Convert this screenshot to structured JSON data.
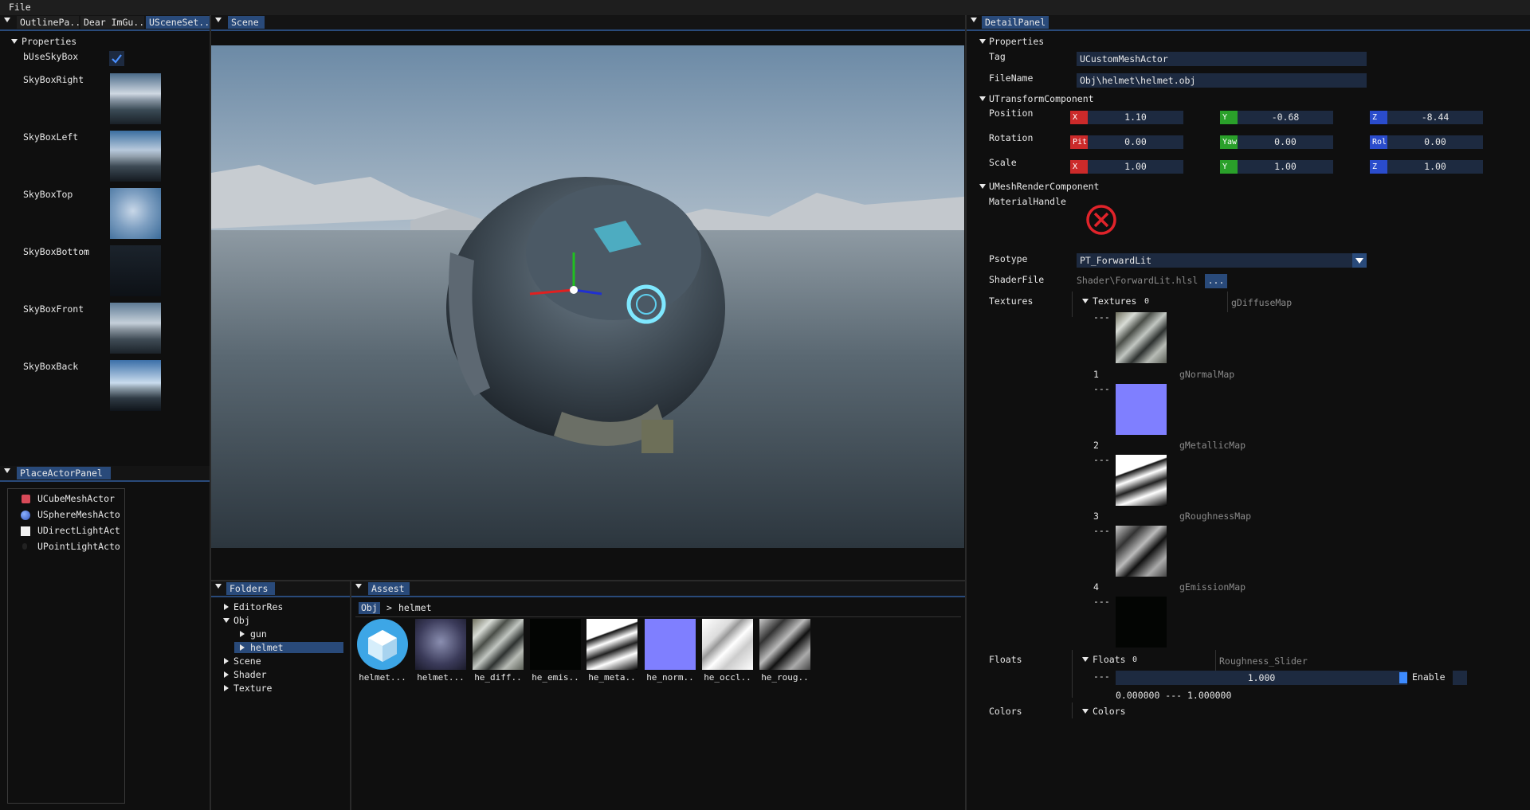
{
  "menu": {
    "file": "File"
  },
  "left_top": {
    "tabs": [
      "OutlinePa..",
      "Dear ImGu..",
      "USceneSet.."
    ],
    "section": "Properties",
    "use_skybox_label": "bUseSkyBox",
    "use_skybox_checked": true,
    "skybox": [
      {
        "label": "SkyBoxRight"
      },
      {
        "label": "SkyBoxLeft"
      },
      {
        "label": "SkyBoxTop"
      },
      {
        "label": "SkyBoxBottom"
      },
      {
        "label": "SkyBoxFront"
      },
      {
        "label": "SkyBoxBack"
      }
    ]
  },
  "place_actor": {
    "tab": "PlaceActorPanel",
    "items": [
      {
        "label": "UCubeMeshActor",
        "icon": "cube-icon"
      },
      {
        "label": "USphereMeshActo",
        "icon": "sphere-icon"
      },
      {
        "label": "UDirectLightAct",
        "icon": "sun-icon"
      },
      {
        "label": "UPointLightActo",
        "icon": "bulb-icon"
      }
    ]
  },
  "scene": {
    "tab": "Scene"
  },
  "folders": {
    "tab": "Folders",
    "items": [
      {
        "label": "EditorRes"
      },
      {
        "label": "Obj"
      },
      {
        "label": "gun"
      },
      {
        "label": "helmet"
      },
      {
        "label": "Scene"
      },
      {
        "label": "Shader"
      },
      {
        "label": "Texture"
      }
    ]
  },
  "assets": {
    "tab": "Assest",
    "breadcrumb_root": "Obj",
    "breadcrumb_sep": ">",
    "breadcrumb_current": "helmet",
    "items": [
      {
        "label": "helmet...",
        "icon": "mesh-icon"
      },
      {
        "label": "helmet...",
        "icon": "material-icon"
      },
      {
        "label": "he_diff..",
        "icon": "texture-icon"
      },
      {
        "label": "he_emis..",
        "icon": "texture-icon"
      },
      {
        "label": "he_meta..",
        "icon": "texture-icon"
      },
      {
        "label": "he_norm..",
        "icon": "texture-icon"
      },
      {
        "label": "he_occl..",
        "icon": "texture-icon"
      },
      {
        "label": "he_roug..",
        "icon": "texture-icon"
      }
    ]
  },
  "detail": {
    "tab": "DetailPanel",
    "properties": "Properties",
    "tag_label": "Tag",
    "tag_value": "UCustomMeshActor",
    "filename_label": "FileName",
    "filename_value": "Obj\\helmet\\helmet.obj",
    "transform": "UTransformComponent",
    "position_label": "Position",
    "rotation_label": "Rotation",
    "scale_label": "Scale",
    "axes": {
      "x": "X",
      "y": "Y",
      "z": "Z",
      "pitch": "Pit",
      "yaw": "Yaw",
      "roll": "Rol"
    },
    "position": [
      "1.10",
      "-0.68",
      "-8.44"
    ],
    "rotation": [
      "0.00",
      "0.00",
      "0.00"
    ],
    "scale": [
      "1.00",
      "1.00",
      "1.00"
    ],
    "mesh_render": "UMeshRenderComponent",
    "material_label": "MaterialHandle",
    "psotype_label": "Psotype",
    "psotype_value": "PT_ForwardLit",
    "shaderfile_label": "ShaderFile",
    "shaderfile_value": "Shader\\ForwardLit.hlsl",
    "browse_label": "...",
    "textures_label": "Textures",
    "textures_header": "Textures",
    "textures": [
      {
        "index": "0",
        "dash": "---",
        "name": "gDiffuseMap"
      },
      {
        "index": "1",
        "dash": "---",
        "name": "gNormalMap"
      },
      {
        "index": "2",
        "dash": "---",
        "name": "gMetallicMap"
      },
      {
        "index": "3",
        "dash": "---",
        "name": "gRoughnessMap"
      },
      {
        "index": "4",
        "dash": "---",
        "name": "gEmissionMap"
      }
    ],
    "floats_label": "Floats",
    "floats_header": "Floats",
    "floats_index": "0",
    "float_name": "Roughness_Slider",
    "float_dash": "---",
    "float_value": "1.000",
    "float_fraction": 1.0,
    "enable_label": "Enable",
    "float_range": "0.000000 --- 1.000000",
    "colors_label": "Colors",
    "colors_header": "Colors"
  },
  "colors": {
    "accent": "#294a7a",
    "field": "#1d2a40",
    "error": "#e0232a"
  }
}
